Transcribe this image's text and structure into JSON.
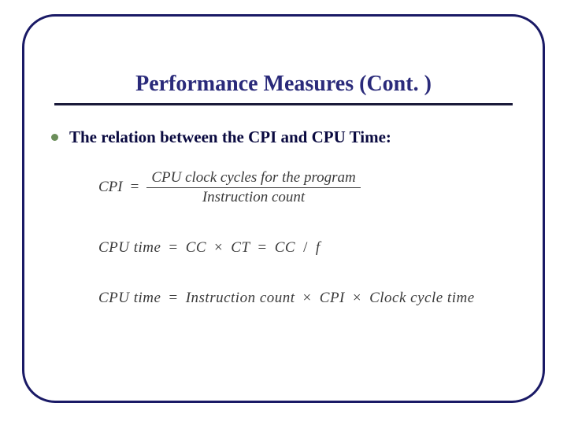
{
  "slide": {
    "title": "Performance Measures (Cont. )",
    "bullet1": "The relation between the CPI and CPU Time:"
  },
  "equations": {
    "eq1": {
      "lhs": "CPI",
      "eq": " = ",
      "num": "CPU clock cycles for the program",
      "den": "Instruction count"
    },
    "eq2": {
      "lhs": "CPU time",
      "eq1": " = ",
      "a": "CC",
      "times1": " × ",
      "b": "CT",
      "eq2": " = ",
      "c": "CC",
      "slash": "/",
      "d": "f"
    },
    "eq3": {
      "lhs": "CPU time",
      "eq": " = ",
      "a": "Instruction count",
      "times1": " × ",
      "b": "CPI",
      "times2": " × ",
      "c": "Clock cycle time"
    }
  }
}
